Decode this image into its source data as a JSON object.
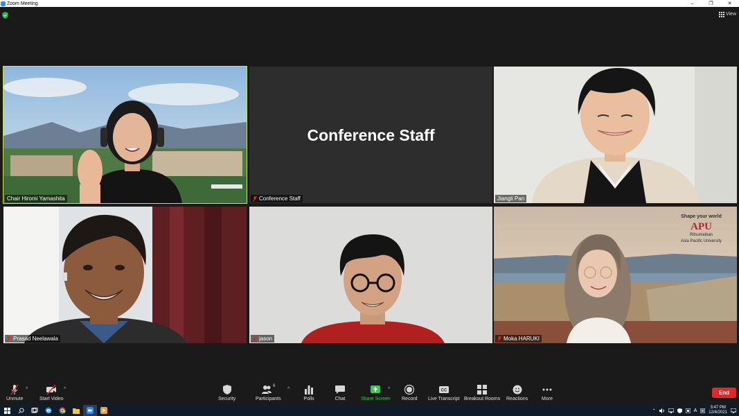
{
  "window": {
    "title": "Zoom Meeting",
    "minimize": "–",
    "restore": "❐",
    "close": "✕"
  },
  "header": {
    "view_label": "View"
  },
  "tiles": [
    {
      "name": "Chair Hiromi Yamashita",
      "active": true,
      "muted": false
    },
    {
      "name": "Conference Staff",
      "display_text": "Conference Staff",
      "muted": true
    },
    {
      "name": "Jiangli Pan",
      "muted": false
    },
    {
      "name": "Prasad  Neelawala",
      "muted": true
    },
    {
      "name": "jason",
      "muted": true
    },
    {
      "name": "Moka HARUKI",
      "muted": true
    }
  ],
  "background_text": {
    "tagline": "Shape your world",
    "logo": "APU",
    "university": "Ritsumeikan",
    "university_line2": "Asia Pacific University"
  },
  "toolbar": {
    "unmute": "Unmute",
    "start_video": "Start Video",
    "security": "Security",
    "participants": "Participants",
    "participants_count": "6",
    "polls": "Polls",
    "chat": "Chat",
    "share_screen": "Share Screen",
    "record": "Record",
    "live_transcript": "Live Transcript",
    "breakout_rooms": "Breakout Rooms",
    "reactions": "Reactions",
    "more": "More",
    "end": "End",
    "caret": "^"
  },
  "taskbar": {
    "time": "3:47 PM",
    "date": "12/4/2021",
    "ime": "A"
  },
  "colors": {
    "accent_green": "#3ec45b",
    "active_speaker": "#c8e04a",
    "end_red": "#e02828",
    "mute_red": "#e02828"
  }
}
